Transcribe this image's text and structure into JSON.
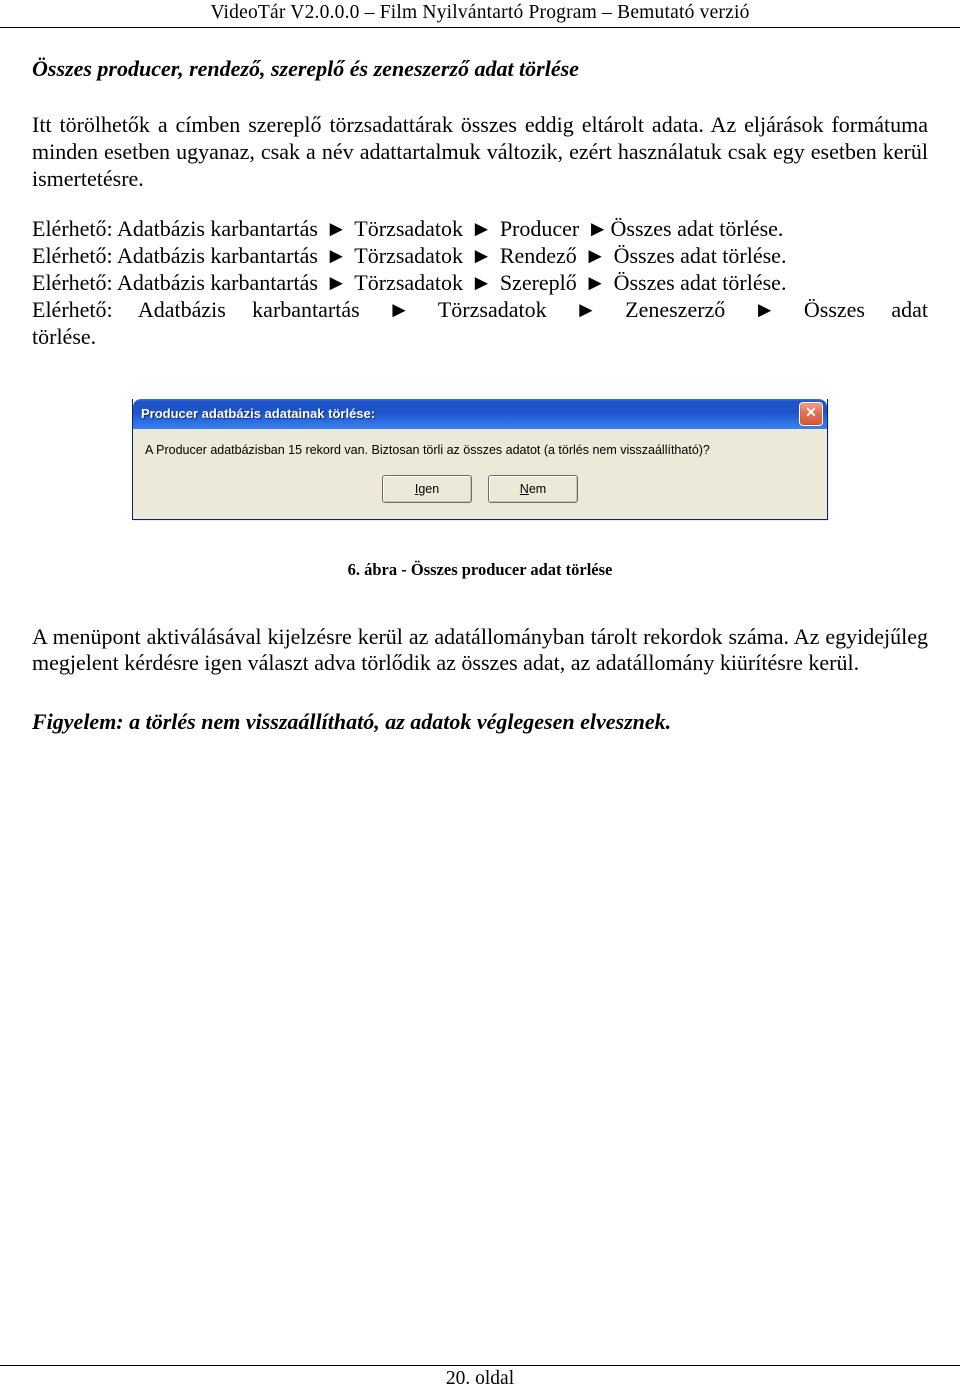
{
  "header": {
    "text": "VideoTár V2.0.0.0 – Film Nyilvántartó Program – Bemutató verzió"
  },
  "section": {
    "title": "Összes producer, rendező, szereplő és zeneszerző adat törlése"
  },
  "para1": "Itt törölhetők a címben szereplő törzsadattárak összes eddig eltárolt adata. Az eljárások formátuma minden esetben ugyanaz, csak a név adattartalmuk változik, ezért használatuk csak egy esetben kerül ismertetésre.",
  "paths": {
    "prefix": "Elérhető:",
    "arrow": "►",
    "seg1": "Adatbázis karbantartás",
    "seg2": "Törzsadatok",
    "end_producer": "Producer",
    "end_rendezo": "Rendező",
    "end_szereplo": "Szereplő",
    "end_zeneszerzo": "Zeneszerző",
    "tail_short": "Összes adat törlése.",
    "tail_wrap_a": "Összes adat",
    "tail_wrap_b": "törlése."
  },
  "dialog": {
    "title": "Producer adatbázis adatainak törlése:",
    "message": "A Producer adatbázisban 15 rekord van.  Biztosan törli az összes adatot (a törlés nem visszaállítható)?",
    "yes_u": "I",
    "yes_rest": "gen",
    "no_u": "N",
    "no_rest": "em",
    "close_glyph": "✕"
  },
  "caption": "6. ábra - Összes producer adat törlése",
  "para2": "A menüpont aktiválásával kijelzésre kerül az adatállományban tárolt rekordok száma. Az egyidejűleg megjelent kérdésre igen választ adva törlődik az összes adat, az adatállomány kiürítésre kerül.",
  "warning": "Figyelem: a törlés nem visszaállítható, az adatok véglegesen elvesznek.",
  "footer": {
    "text": "20. oldal"
  }
}
